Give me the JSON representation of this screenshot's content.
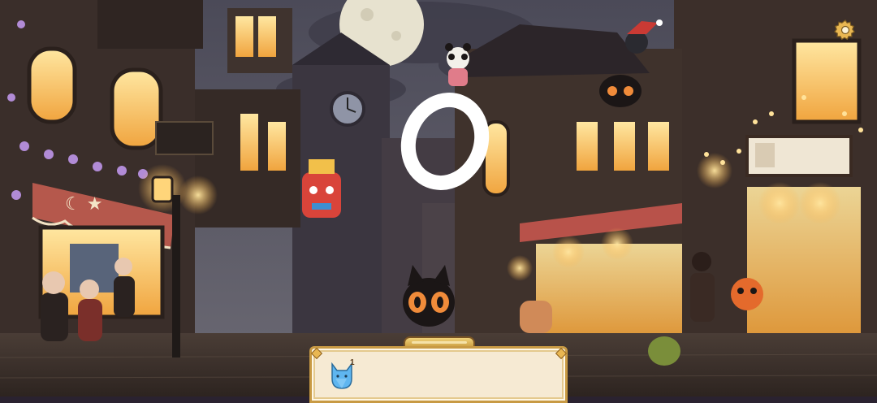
{
  "hud": {
    "settings_icon": "gear-icon"
  },
  "inventory": {
    "items": [
      {
        "icon": "blue-cat-token-icon",
        "count": "1"
      }
    ]
  },
  "overlay": {
    "glyph": "0"
  },
  "colors": {
    "sky": "#5d5a66",
    "moon": "#e7e2cf",
    "warm_light": "#ffcf6a",
    "tray_bg": "#f6ead3",
    "tray_border": "#c89a44",
    "token_blue": "#5fb6f0"
  }
}
